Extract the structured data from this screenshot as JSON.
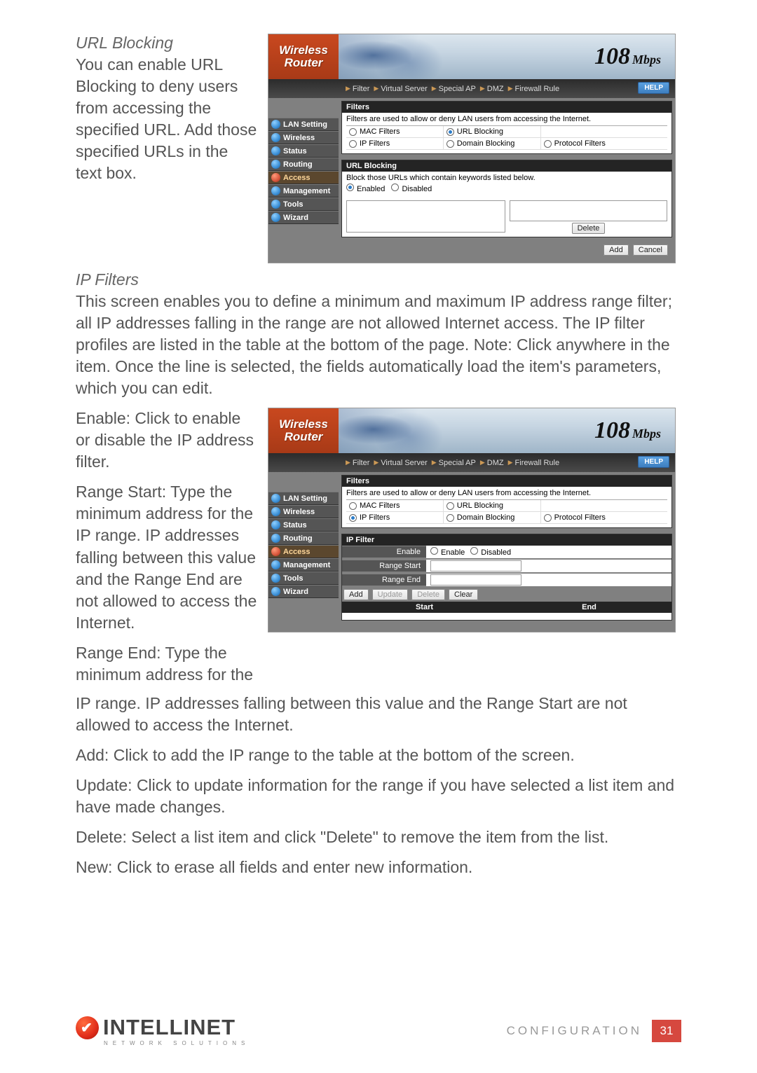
{
  "section1": {
    "heading": "URL Blocking",
    "body": "You can enable URL Blocking to deny users from accessing the specified URL. Add those specified URLs in the text box."
  },
  "section2": {
    "heading": "IP Filters",
    "intro": "This screen enables you to define a minimum and maximum IP address range filter; all IP addresses falling in the range are not allowed Internet access. The IP filter profiles are listed in the table at the bottom of the page. Note: Click anywhere in the item. Once the line is selected, the fields automatically load the item's parameters, which you can edit.",
    "enable": "Enable: Click to enable or disable the IP address filter.",
    "rangeStart": "Range Start: Type the minimum address for the IP range. IP addresses falling between this value and the Range End are not allowed to access the Internet.",
    "rangeEndA": "Range End: Type the minimum address for the",
    "rangeEndB": "IP range. IP addresses falling between this value and the Range Start are not allowed to access the Internet.",
    "add": "Add: Click to add the IP range to the table at the bottom of the screen.",
    "update": "Update: Click to update information for the range if you have selected a list item and have made changes.",
    "delete": "Delete: Select a list item and click \"Delete\" to remove the item from the list.",
    "new": "New: Click to erase all fields and enter new information."
  },
  "router": {
    "brandLine1": "Wireless",
    "brandLine2": "Router",
    "speed": "108",
    "speedUnit": "Mbps",
    "help": "HELP",
    "tabs": [
      "Filter",
      "Virtual Server",
      "Special AP",
      "DMZ",
      "Firewall Rule"
    ],
    "nav": [
      "LAN Setting",
      "Wireless",
      "Status",
      "Routing",
      "Access",
      "Management",
      "Tools",
      "Wizard"
    ],
    "filtersHead": "Filters",
    "filtersDesc": "Filters are used to allow or deny LAN users from accessing the Internet.",
    "filterOptions": {
      "mac": "MAC Filters",
      "url": "URL Blocking",
      "ip": "IP Filters",
      "domain": "Domain Blocking",
      "proto": "Protocol Filters"
    },
    "urlBlockHead": "URL Blocking",
    "urlBlockDesc": "Block those URLs which contain keywords listed below.",
    "enabled": "Enabled",
    "disabled": "Disabled",
    "deleteBtn": "Delete",
    "addBtn": "Add",
    "cancelBtn": "Cancel",
    "ipFilterHead": "IP Filter",
    "enableLabel": "Enable",
    "enableOpt": "Enable",
    "disableOpt": "Disabled",
    "rangeStartLabel": "Range Start",
    "rangeEndLabel": "Range End",
    "updateBtn": "Update",
    "clearBtn": "Clear",
    "startCol": "Start",
    "endCol": "End"
  },
  "footer": {
    "brand": "INTELLINET",
    "sub": "NETWORK SOLUTIONS",
    "section": "CONFIGURATION",
    "page": "31"
  }
}
